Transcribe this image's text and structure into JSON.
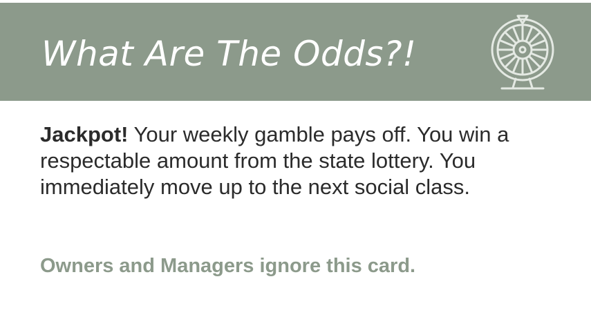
{
  "card": {
    "title": "What Are The Odds?!",
    "icon": "prize-wheel-icon",
    "body_lead": "Jackpot!",
    "body_text": " Your weekly gamble pays off. You win a respectable amount from the state lottery. You immediately move up to the next social class.",
    "note": "Owners and Managers ignore this card."
  },
  "colors": {
    "header_bg": "#8c9a8b",
    "title_text": "#ffffff",
    "body_text": "#2b2b2b",
    "note_text": "#8c9a8b"
  }
}
